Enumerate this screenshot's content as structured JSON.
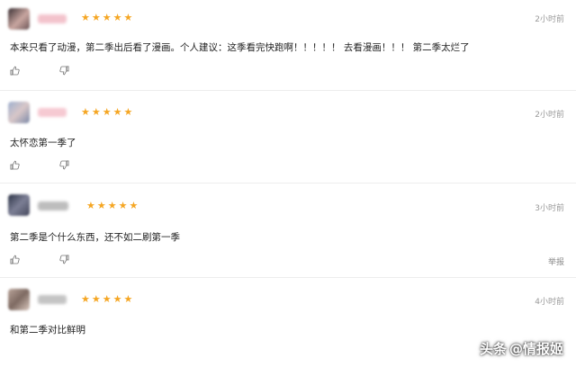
{
  "comments": [
    {
      "rating": 5,
      "time": "2小时前",
      "text": "本来只看了动漫，第二季出后看了漫画。个人建议：这季看完快跑啊！！！！！ 去看漫画！！！ 第二季太烂了",
      "avatar_colors": [
        "#3a3034",
        "#c9a6a0",
        "#6b5456"
      ],
      "name_color": "#f3c3cc"
    },
    {
      "rating": 5,
      "time": "2小时前",
      "text": "太怀恋第一季了",
      "avatar_colors": [
        "#9fb0cf",
        "#d8c7c8",
        "#7c89a8"
      ],
      "name_color": "#f6c9d2"
    },
    {
      "rating": 5,
      "time": "3小时前",
      "text": "第二季是个什么东西，还不如二刷第一季",
      "report_label": "举报",
      "avatar_colors": [
        "#2c3346",
        "#7c7f95",
        "#45485c"
      ],
      "name_color": "#bdbdbd"
    },
    {
      "rating": 5,
      "time": "4小时前",
      "text": "和第二季对比鲜明",
      "avatar_colors": [
        "#b9a49a",
        "#7e6a62",
        "#d9c7bd"
      ],
      "name_color": "#c4c4c4"
    }
  ],
  "icons": {
    "like": "thumbs-up-icon",
    "dislike": "thumbs-down-icon",
    "star": "star-icon"
  },
  "colors": {
    "star": "#f5a623",
    "time": "#9a9a9a"
  },
  "watermark": {
    "platform": "头条",
    "handle": "@情报姬"
  }
}
